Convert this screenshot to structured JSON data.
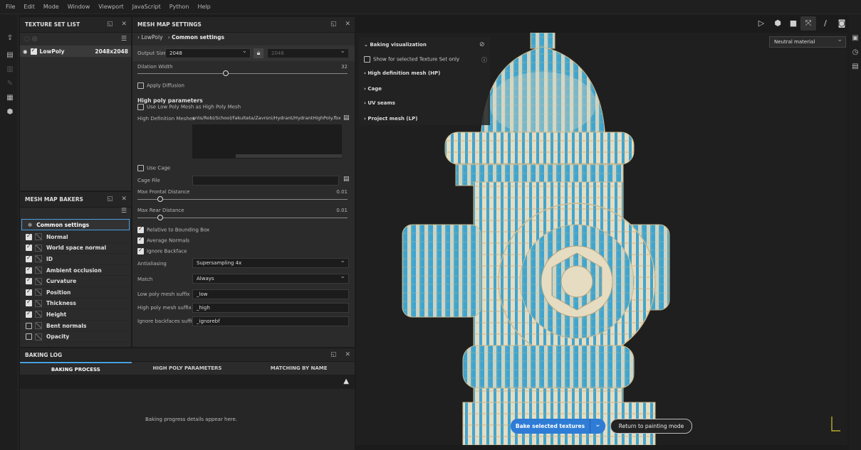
{
  "menu": [
    "File",
    "Edit",
    "Mode",
    "Window",
    "Viewport",
    "JavaScript",
    "Python",
    "Help"
  ],
  "texture_set": {
    "title": "TEXTURE SET LIST",
    "row_name": "LowPoly",
    "row_size": "2048x2048"
  },
  "bakers": {
    "title": "MESH MAP BAKERS",
    "common": "Common settings",
    "items": [
      {
        "label": "Normal",
        "checked": true
      },
      {
        "label": "World space normal",
        "checked": true
      },
      {
        "label": "ID",
        "checked": true
      },
      {
        "label": "Ambient occlusion",
        "checked": true
      },
      {
        "label": "Curvature",
        "checked": true
      },
      {
        "label": "Position",
        "checked": true
      },
      {
        "label": "Thickness",
        "checked": true
      },
      {
        "label": "Height",
        "checked": true
      },
      {
        "label": "Bent normals",
        "checked": false
      },
      {
        "label": "Opacity",
        "checked": false
      }
    ]
  },
  "mesh_settings": {
    "title": "MESH MAP SETTINGS",
    "breadcrumb_1": "LowPoly",
    "breadcrumb_2": "Common settings",
    "output_size_label": "Output Size",
    "output_size": "2048",
    "output_size_locked": "2048",
    "dilation_label": "Dilation Width",
    "dilation_value": "32",
    "dilation_fraction": 0.42,
    "apply_diffusion": "Apply Diffusion",
    "hp_params_title": "High poly parameters",
    "use_lp_as_hp": "Use Low Poly Mesh as High Poly Mesh",
    "hd_meshes_label": "High Definition Meshes",
    "hd_meshes_value": "ents/Robi/School/Fakulteta/Zavrsni/Hydrant/HydrantHighPoly.fbx",
    "use_cage": "Use Cage",
    "cage_file_label": "Cage File",
    "max_frontal_label": "Max Frontal Distance",
    "max_frontal_value": "0.01",
    "max_rear_label": "Max Rear Distance",
    "max_rear_value": "0.01",
    "relative_bbox": "Relative to Bounding Box",
    "average_normals": "Average Normals",
    "ignore_backface": "Ignore Backface",
    "antialiasing_label": "Antialiasing",
    "antialiasing_value": "Supersampling 4x",
    "match_label": "Match",
    "match_value": "Always",
    "low_suffix_label": "Low poly mesh suffix",
    "low_suffix_value": "_low",
    "high_suffix_label": "High poly mesh suffix",
    "high_suffix_value": "_high",
    "ignore_suffix_label": "Ignore backfaces suffix",
    "ignore_suffix_value": "_ignorebf"
  },
  "baking_log": {
    "title": "BAKING LOG",
    "tabs": [
      "BAKING PROCESS",
      "HIGH POLY PARAMETERS",
      "MATCHING BY NAME"
    ],
    "placeholder": "Baking progress details appear here."
  },
  "viewport": {
    "material": "Neutral material",
    "vis_title": "Baking visualization",
    "show_selected": "Show for selected Texture Set only",
    "sections": [
      "High definition mesh (HP)",
      "Cage",
      "UV seams",
      "Project mesh (LP)"
    ],
    "bake_button": "Bake selected textures",
    "return_button": "Return to painting mode"
  },
  "colors": {
    "accent": "#2e7cd6",
    "cyan": "#3fa5cf",
    "cream": "#e6dcc2"
  }
}
